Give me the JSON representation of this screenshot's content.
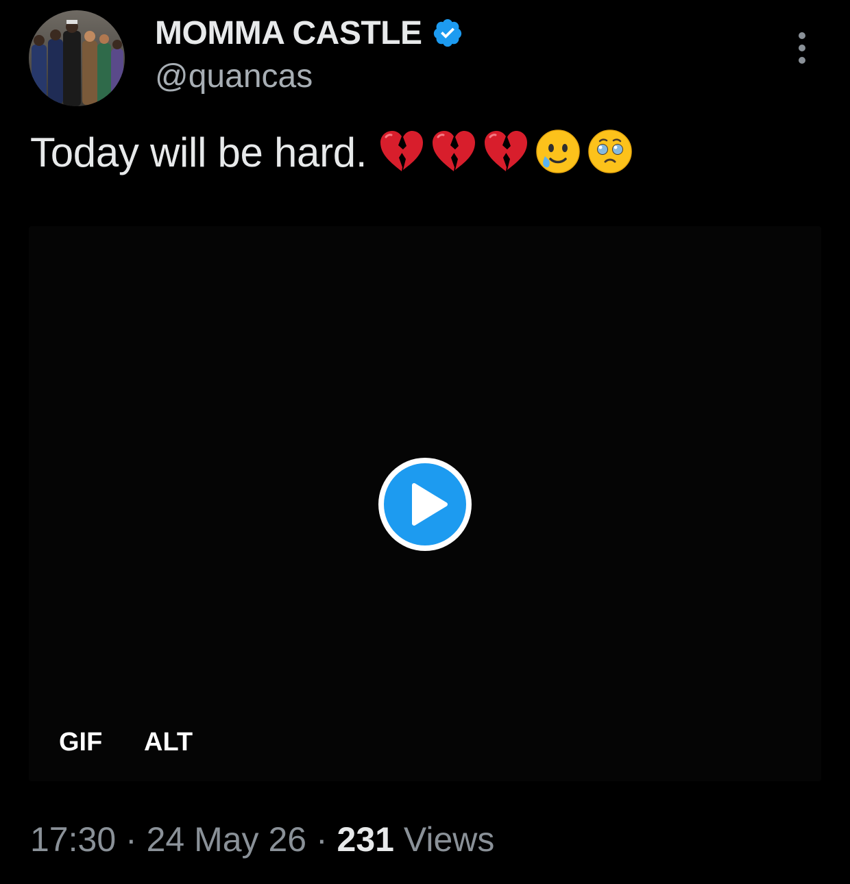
{
  "author": {
    "display_name": "MOMMA CASTLE",
    "handle": "@quancas",
    "verified": true,
    "avatar_icon": "profile-photo-avatar"
  },
  "tweet": {
    "text": "Today will be hard.",
    "emojis": [
      "💔",
      "💔",
      "💔",
      "🥲",
      "🥹"
    ]
  },
  "media": {
    "type_badge": "GIF",
    "alt_badge": "ALT",
    "play_icon": "play-icon"
  },
  "meta": {
    "time": "17:30",
    "separator": "·",
    "date": "24 May 26",
    "views_count": "231",
    "views_label": "Views"
  },
  "colors": {
    "background": "#000000",
    "accent_blue": "#1d9bf0",
    "text_primary": "#e7e9ea",
    "text_secondary": "#8a9198"
  },
  "icons": {
    "verified": "verified-badge-icon",
    "more": "more-options-icon"
  }
}
